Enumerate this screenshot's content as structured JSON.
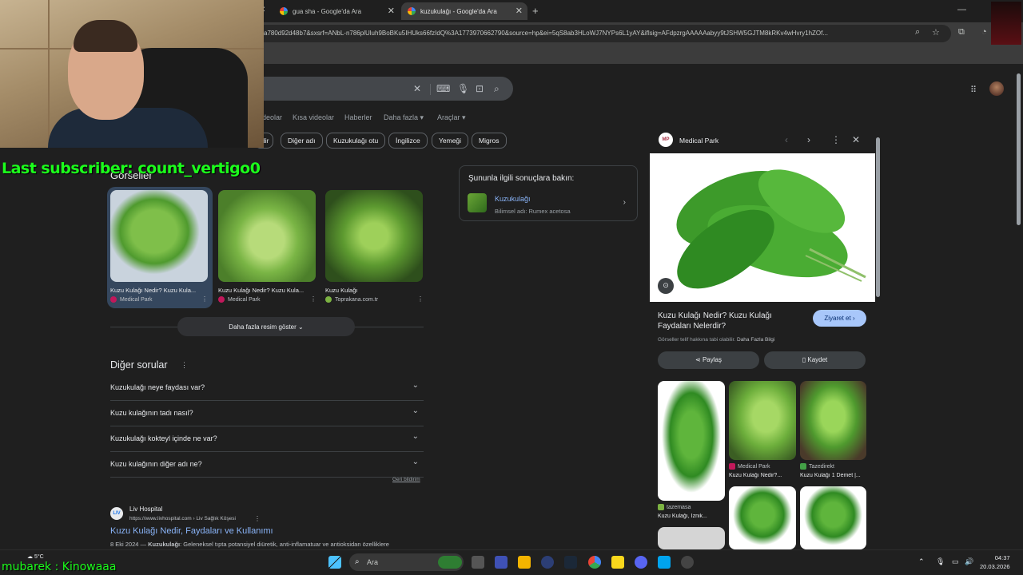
{
  "browser": {
    "tabs": [
      {
        "label": "gua sha - Google'da Ara"
      },
      {
        "label": "kuzukulağı - Google'da Ara"
      }
    ],
    "new_tab": "+",
    "url": "a780d92d48b7&sxsrf=ANbL-n786plUluh9BoBKu5IHUks66fzIdQ%3A1773970662790&source=hp&ei=5qS8ab3HLoWJ7NYPs6L1yAY&iflsig=AFdpzrgAAAAAabyy9tJSHW5GJTM8kRKv4wHvry1hZOf..."
  },
  "search": {
    "nav_tabs": [
      "deolar",
      "Kısa videolar",
      "Haberler",
      "Daha fazla ▾",
      "Araçlar ▾"
    ],
    "chips": [
      "dir",
      "Diğer adı",
      "Kuzukulağı otu",
      "İngilizce",
      "Yemeği",
      "Migros"
    ]
  },
  "overlay": {
    "subscriber": "Last subscriber: count_vertigo0",
    "ticker": "mubarek : Kinowaaa"
  },
  "images_section": {
    "heading": "Görseller",
    "items": [
      {
        "caption": "Kuzu Kulağı Nedir? Kuzu Kula...",
        "source": "Medical Park"
      },
      {
        "caption": "Kuzu Kulağı Nedir? Kuzu Kula...",
        "source": "Medical Park"
      },
      {
        "caption": "Kuzu Kulağı",
        "source": "Toprakana.com.tr"
      }
    ],
    "more_button": "Daha fazla resim göster ⌄"
  },
  "related": {
    "heading": "Şununla ilgili sonuçlara bakın:",
    "name": "Kuzukulağı",
    "subtitle": "Bilimsel adı: Rumex acetosa"
  },
  "questions": {
    "heading": "Diğer sorular",
    "items": [
      "Kuzukulağı neye faydası var?",
      "Kuzu kulağının tadı nasıl?",
      "Kuzukulağı kokteyl içinde ne var?",
      "Kuzu kulağının diğer adı ne?"
    ],
    "feedback": "Geri bildirim"
  },
  "result": {
    "site": "Liv Hospital",
    "url": "https://www.livhospital.com › Liv Sağlık Köşesi",
    "title": "Kuzu Kulağı Nedir, Faydaları ve Kullanımı",
    "date": "8 Eki 2024 — ",
    "bold": "Kuzukulağı",
    "snippet": ": Geleneksel tıpta potansiyel diüretik, anti-inflamatuar ve antioksidan özelliklere"
  },
  "panel": {
    "logo": "MP",
    "site": "Medical Park",
    "title": "Kuzu Kulağı Nedir? Kuzu Kulağı Faydaları Nelerdir?",
    "visit": "Ziyaret et ›",
    "copyright": "Görseller telif hakkına tabi olabilir.",
    "learn_more": "Daha Fazla Bilgi",
    "share": "Paylaş",
    "save": "Kaydet",
    "related": [
      {
        "source": "tazemasa",
        "caption": "Kuzu Kulağı, İznik..."
      },
      {
        "source": "Medical Park",
        "caption": "Kuzu Kulağı Nedir?..."
      },
      {
        "source": "Tazedirekt",
        "caption": "Kuzu Kulağı 1 Demet |..."
      }
    ]
  },
  "taskbar": {
    "weather": "5°C",
    "search": "Ara",
    "time": "04:37",
    "date": "20.03.2026"
  }
}
